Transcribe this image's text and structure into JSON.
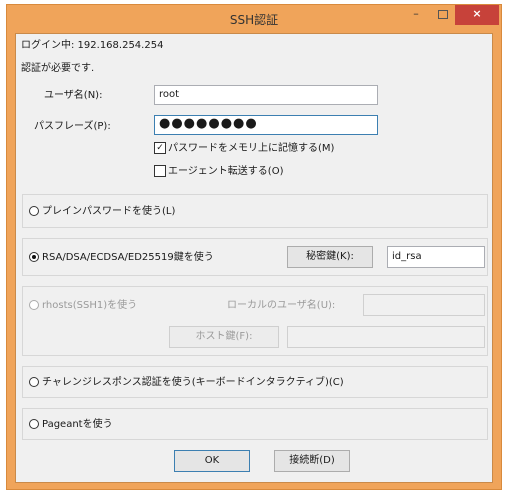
{
  "window": {
    "title": "SSH認証",
    "min_glyph": "–",
    "close_glyph": "×"
  },
  "status": {
    "login_line": "ログイン中: 192.168.254.254",
    "auth_required": "認証が必要です."
  },
  "username": {
    "label": "ユーザ名(N):",
    "value": "root"
  },
  "passphrase": {
    "label": "パスフレーズ(P):",
    "dots": "●●●●●●●●"
  },
  "options": {
    "remember_password": {
      "label": "パスワードをメモリ上に記憶する(M)",
      "checked": true
    },
    "agent_forwarding": {
      "label": "エージェント転送する(O)",
      "checked": false
    }
  },
  "methods": {
    "plain_password": {
      "label": "プレインパスワードを使う(L)"
    },
    "rsa": {
      "label": "RSA/DSA/ECDSA/ED25519鍵を使う",
      "key_button": "秘密鍵(K):",
      "key_file": "id_rsa"
    },
    "rhosts": {
      "label": "rhosts(SSH1)を使う",
      "local_user_label": "ローカルのユーザ名(U):",
      "host_key_button": "ホスト鍵(F):"
    },
    "challenge": {
      "label": "チャレンジレスポンス認証を使う(キーボードインタラクティブ)(C)"
    },
    "pageant": {
      "label": "Pageantを使う"
    }
  },
  "buttons": {
    "ok": "OK",
    "disconnect": "接続断(D)"
  },
  "colors": {
    "frame": "#f0a45a",
    "close": "#c7423a",
    "focus_border": "#3c7fb1"
  }
}
